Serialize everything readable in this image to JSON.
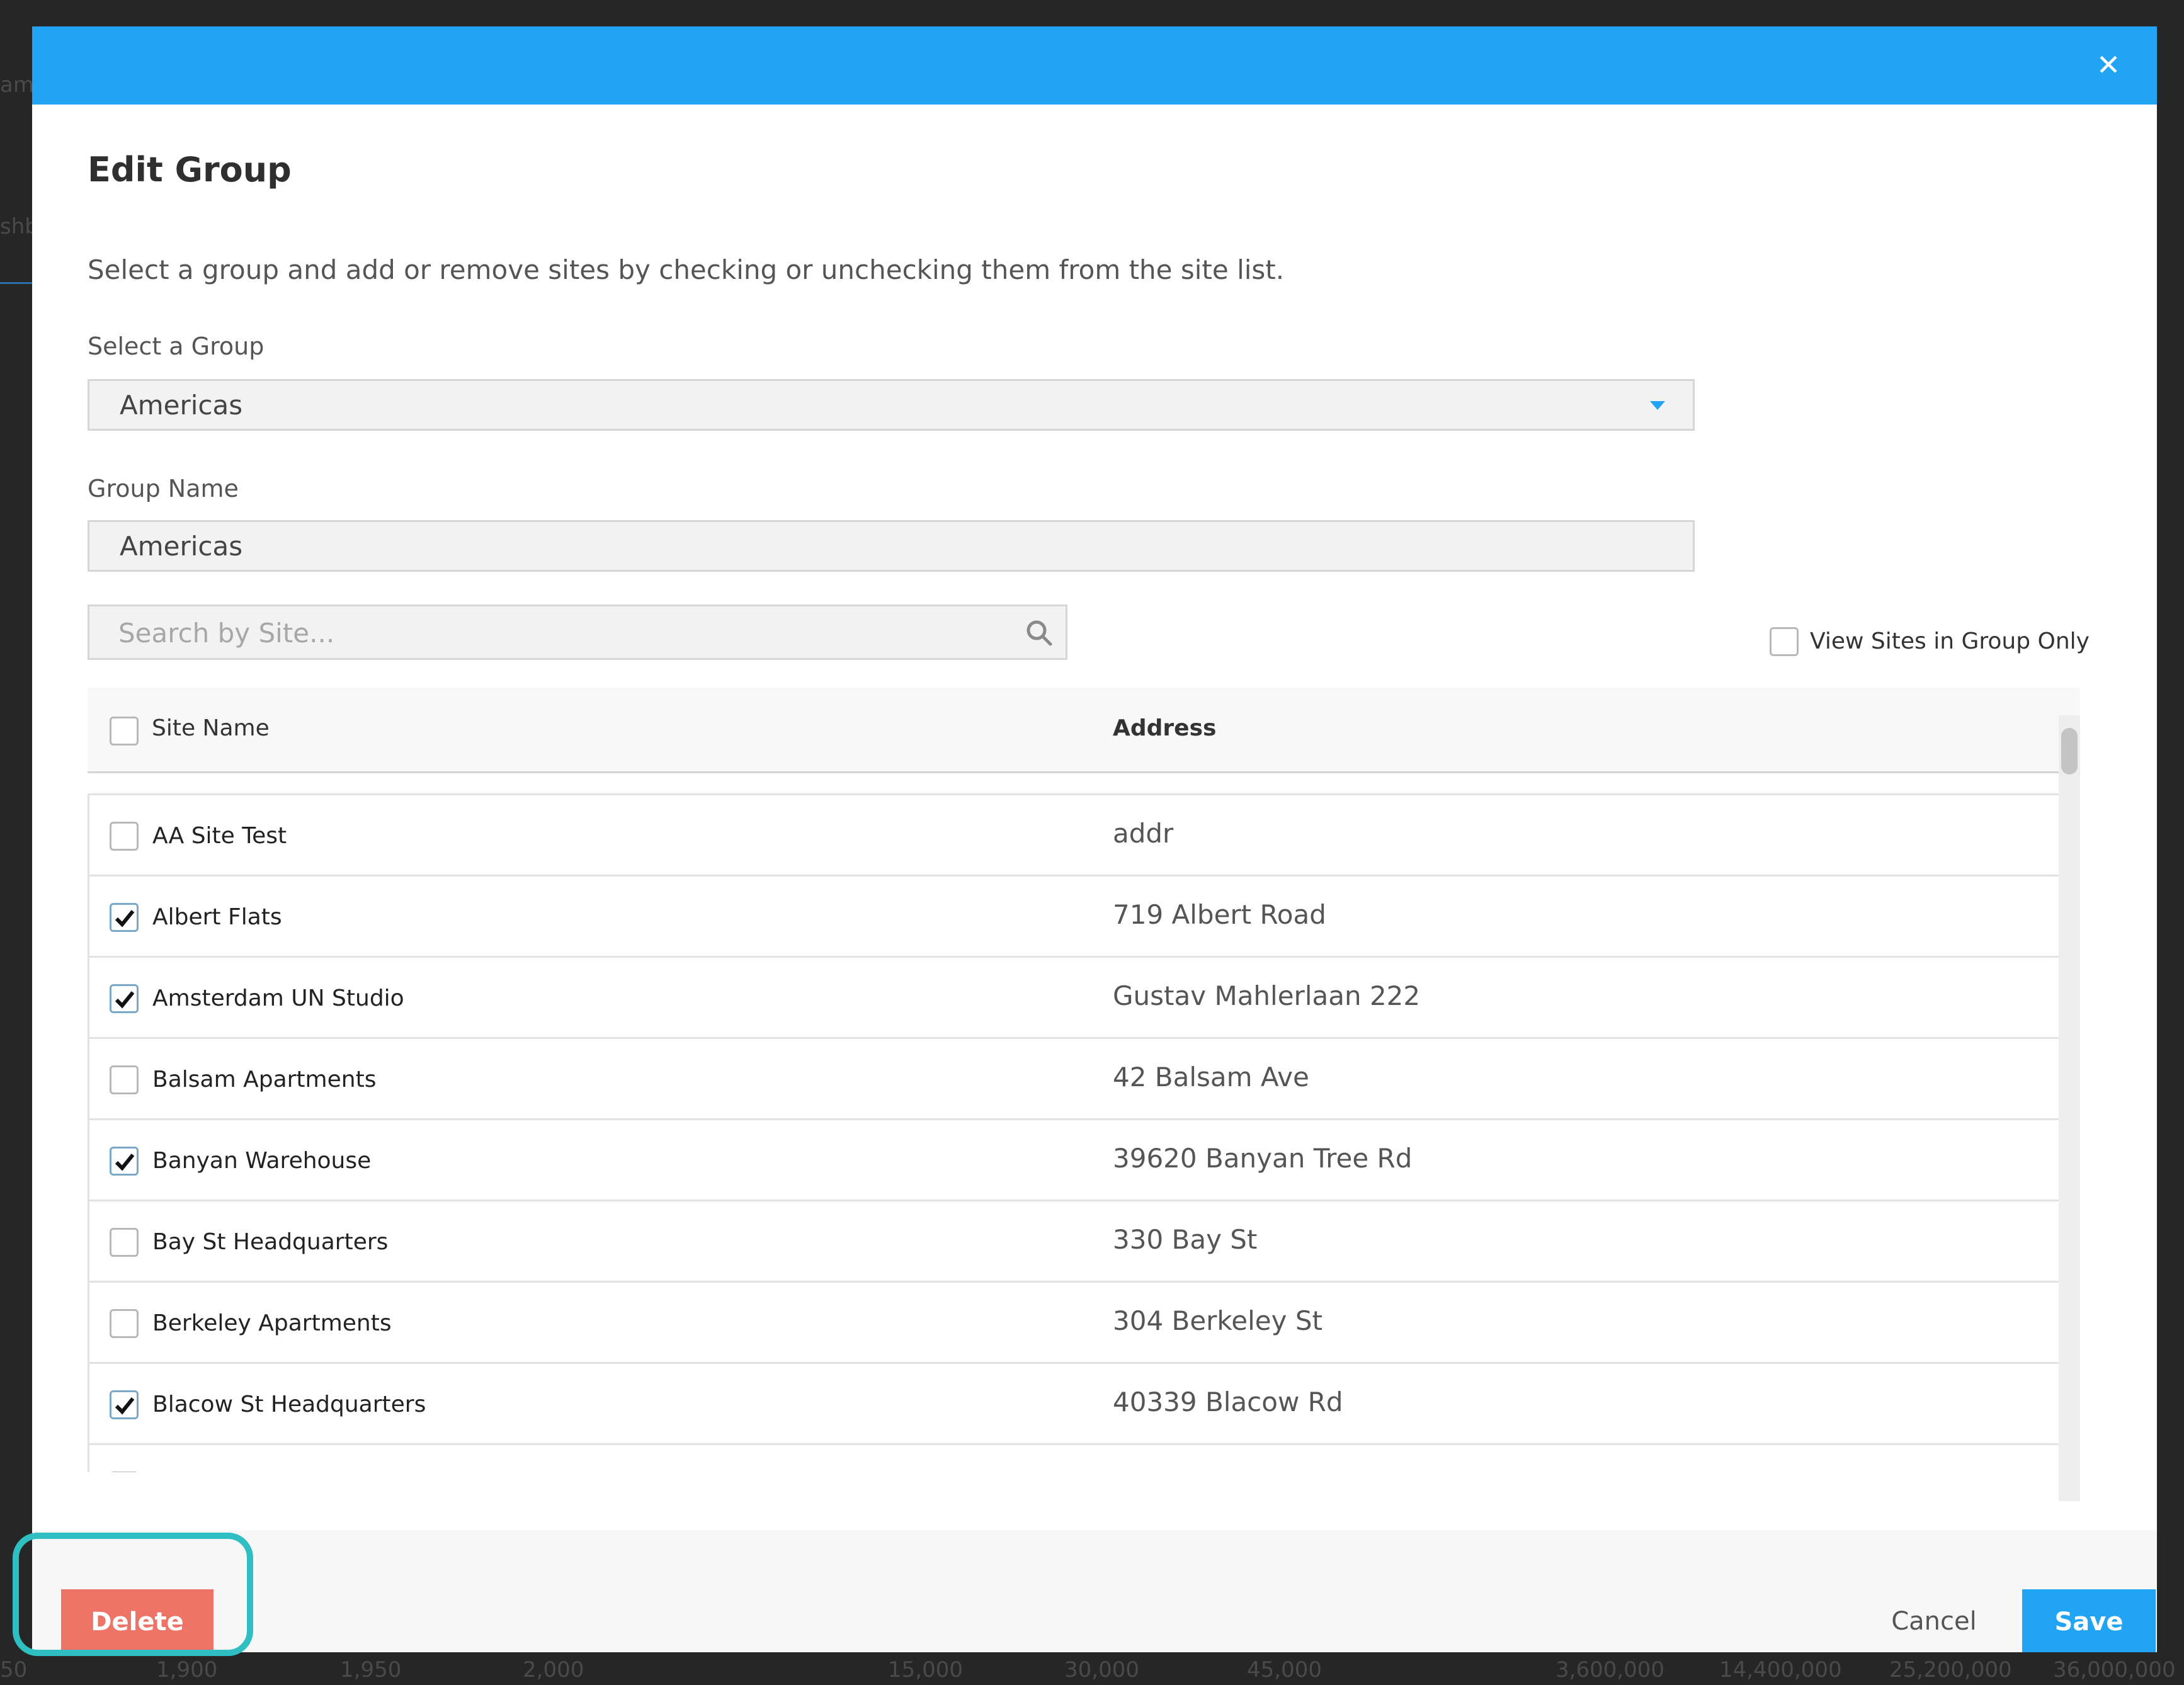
{
  "background": {
    "fragments": [
      "am",
      "shb",
      "50",
      "1,900",
      "1,950",
      "2,000",
      "15,000",
      "30,000",
      "45,000",
      "3,600,000",
      "14,400,000",
      "25,200,000",
      "36,000,000"
    ]
  },
  "modal": {
    "close_icon": "close-icon",
    "title": "Edit Group",
    "subtitle": "Select a group and add or remove sites by checking or unchecking them from the site list.",
    "select_group_label": "Select a Group",
    "select_group_value": "Americas",
    "group_name_label": "Group Name",
    "group_name_value": "Americas",
    "search_placeholder": "Search by Site...",
    "view_only_label": "View Sites in Group Only",
    "view_only_checked": false,
    "columns": {
      "site_name": "Site Name",
      "address": "Address"
    },
    "rows": [
      {
        "site": "AA Site Test",
        "address": "addr",
        "checked": false
      },
      {
        "site": "Albert Flats",
        "address": "719 Albert Road",
        "checked": true
      },
      {
        "site": "Amsterdam UN Studio",
        "address": "Gustav Mahlerlaan 222",
        "checked": true
      },
      {
        "site": "Balsam Apartments",
        "address": "42 Balsam Ave",
        "checked": false
      },
      {
        "site": "Banyan Warehouse",
        "address": "39620 Banyan Tree Rd",
        "checked": true
      },
      {
        "site": "Bay St Headquarters",
        "address": "330 Bay St",
        "checked": false
      },
      {
        "site": "Berkeley Apartments",
        "address": "304 Berkeley St",
        "checked": false
      },
      {
        "site": "Blacow St Headquarters",
        "address": "40339 Blacow Rd",
        "checked": true
      }
    ],
    "footer": {
      "delete_label": "Delete",
      "cancel_label": "Cancel",
      "save_label": "Save"
    }
  },
  "colors": {
    "accent": "#20a4f3",
    "danger": "#ef7468",
    "highlight": "#2fbfc3"
  }
}
